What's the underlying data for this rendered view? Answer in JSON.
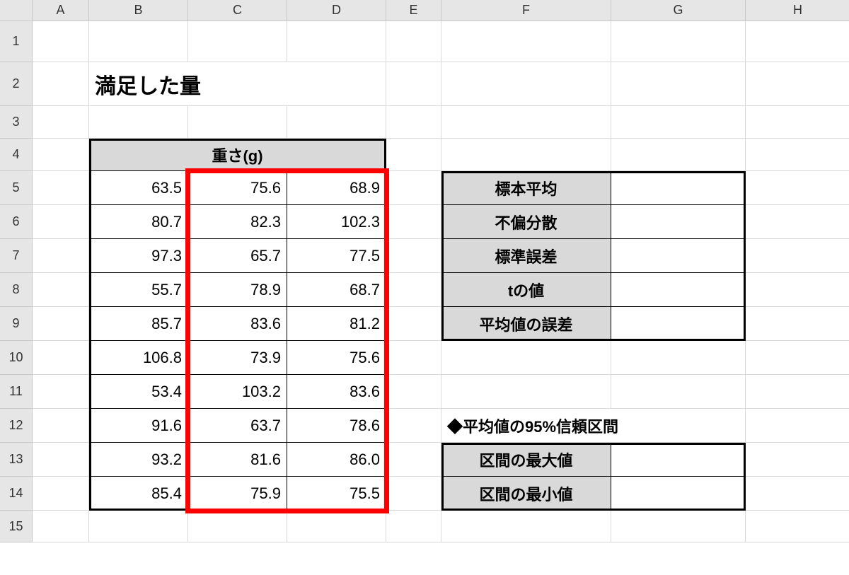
{
  "columns": [
    "A",
    "B",
    "C",
    "D",
    "E",
    "F",
    "G",
    "H"
  ],
  "rows": [
    "1",
    "2",
    "3",
    "4",
    "5",
    "6",
    "7",
    "8",
    "9",
    "10",
    "11",
    "12",
    "13",
    "14",
    "15"
  ],
  "title": "満足した量",
  "weight_header": "重さ(g)",
  "weight_data": [
    [
      "63.5",
      "75.6",
      "68.9"
    ],
    [
      "80.7",
      "82.3",
      "102.3"
    ],
    [
      "97.3",
      "65.7",
      "77.5"
    ],
    [
      "55.7",
      "78.9",
      "68.7"
    ],
    [
      "85.7",
      "83.6",
      "81.2"
    ],
    [
      "106.8",
      "73.9",
      "75.6"
    ],
    [
      "53.4",
      "103.2",
      "83.6"
    ],
    [
      "91.6",
      "63.7",
      "78.6"
    ],
    [
      "93.2",
      "81.6",
      "86.0"
    ],
    [
      "85.4",
      "75.9",
      "75.5"
    ]
  ],
  "stats_labels": [
    "標本平均",
    "不偏分散",
    "標準誤差",
    "tの値",
    "平均値の誤差"
  ],
  "ci_heading": "◆平均値の95%信頼区間",
  "ci_labels": [
    "区間の最大値",
    "区間の最小値"
  ],
  "colWidths": {
    "corner": 46,
    "A": 80,
    "B": 140,
    "C": 140,
    "D": 140,
    "E": 78,
    "F": 240,
    "G": 190,
    "H": 148
  },
  "rowHeights": {
    "1": 58,
    "2": 62,
    "3": 46,
    "4": 46,
    "5": 48,
    "6": 48,
    "7": 48,
    "8": 48,
    "9": 48,
    "10": 48,
    "11": 48,
    "12": 48,
    "13": 48,
    "14": 48,
    "15": 45
  }
}
